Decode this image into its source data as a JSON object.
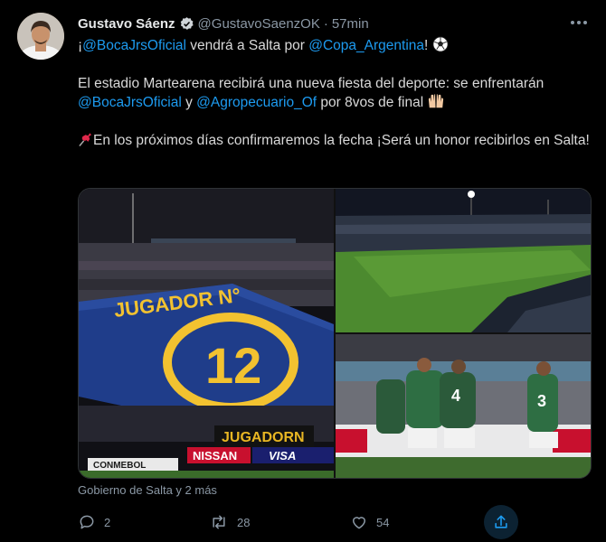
{
  "author": {
    "name": "Gustavo Sáenz",
    "handle": "@GustavoSaenzOK",
    "separator": "·",
    "time": "57min"
  },
  "tweet": {
    "line1": {
      "pre": "¡",
      "mention1": "@BocaJrsOficial",
      "mid": " vendrá a Salta por ",
      "mention2": "@Copa_Argentina",
      "post": "! "
    },
    "line2": {
      "text": "El estadio Martearena recibirá una nueva fiesta del deporte: se enfrentarán"
    },
    "line3": {
      "mention1": "@BocaJrsOficial",
      "mid": " y ",
      "mention2": "@Agropecuario_Of",
      "post": " por 8vos de final "
    },
    "line4": {
      "text": "En los próximos días confirmaremos la fecha ¡Será un honor recibirlos en Salta!"
    }
  },
  "media": {
    "banner_text": "JUGADOR N°",
    "banner_number": "12",
    "board1": "JUGADORN",
    "board2": "NISSAN",
    "board3": "VISA",
    "board4": "CONMEBOL",
    "player_numbers": [
      "4",
      "3"
    ]
  },
  "tagged": "Gobierno de Salta y 2 más",
  "actions": {
    "replies": "2",
    "retweets": "28",
    "likes": "54"
  },
  "colors": {
    "background": "#000000",
    "accent": "#1d9bf0",
    "muted": "#8b98a5",
    "boca_blue": "#1f3d8a",
    "boca_gold": "#f2c230"
  },
  "icons": [
    "verified-badge-icon",
    "more-icon",
    "soccer-ball-icon",
    "raised-hands-icon",
    "pushpin-icon",
    "reply-icon",
    "retweet-icon",
    "like-icon",
    "share-icon"
  ]
}
